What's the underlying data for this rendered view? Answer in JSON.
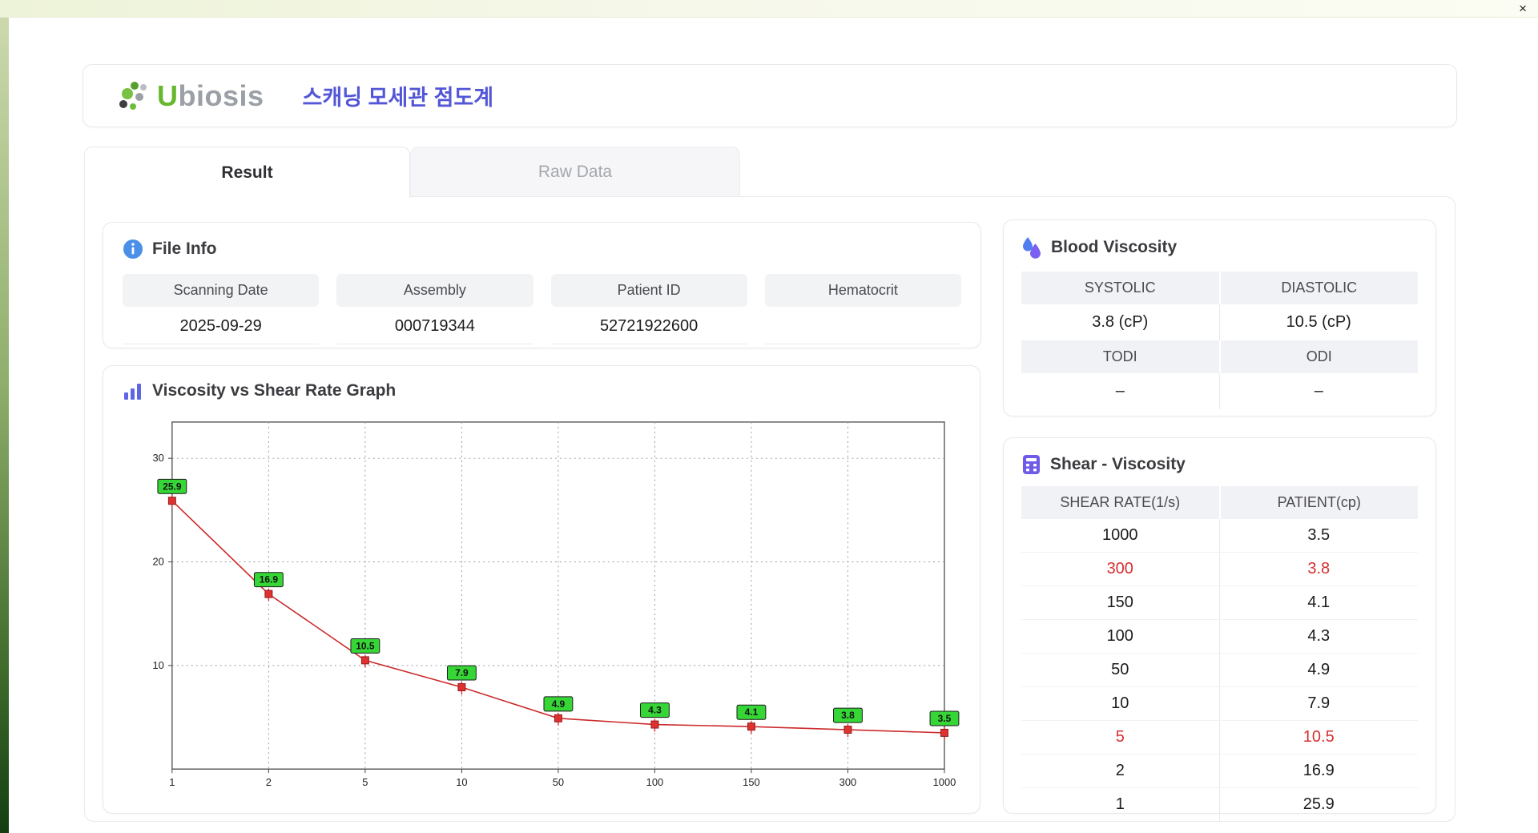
{
  "window": {
    "close_label": "×"
  },
  "header": {
    "logo_u": "U",
    "logo_rest": "biosis",
    "title": "스캐닝 모세관 점도계"
  },
  "tabs": [
    {
      "label": "Result",
      "active": true
    },
    {
      "label": "Raw Data",
      "active": false
    }
  ],
  "file_info": {
    "title": "File Info",
    "fields": [
      {
        "label": "Scanning Date",
        "value": "2025-09-29"
      },
      {
        "label": "Assembly",
        "value": "000719344"
      },
      {
        "label": "Patient ID",
        "value": "52721922600"
      },
      {
        "label": "Hematocrit",
        "value": ""
      }
    ]
  },
  "blood_viscosity": {
    "title": "Blood Viscosity",
    "cells": [
      {
        "label": "SYSTOLIC",
        "value": "3.8 (cP)"
      },
      {
        "label": "DIASTOLIC",
        "value": "10.5 (cP)"
      },
      {
        "label": "TODI",
        "value": "–"
      },
      {
        "label": "ODI",
        "value": "–"
      }
    ]
  },
  "graph": {
    "title": "Viscosity vs Shear Rate Graph"
  },
  "chart_data": {
    "type": "line",
    "title": "Viscosity vs Shear Rate Graph",
    "x": [
      1,
      2,
      5,
      10,
      50,
      100,
      150,
      300,
      1000
    ],
    "x_labels": [
      "1",
      "2",
      "5",
      "10",
      "50",
      "100",
      "150",
      "300",
      "1000"
    ],
    "values": [
      25.9,
      16.9,
      10.5,
      7.9,
      4.9,
      4.3,
      4.1,
      3.8,
      3.5
    ],
    "xlabel": "",
    "ylabel": "",
    "x_scale": "categorical-log-ticks",
    "ylim": [
      0,
      33.5
    ],
    "yticks": [
      10,
      20,
      30
    ],
    "grid": true,
    "legend": "none",
    "line_color": "#cc2a2a",
    "marker_color": "#e03131",
    "marker_edge": "#8f1d1d",
    "label_bg": "#35d635",
    "label_border": "#1a1a1a"
  },
  "shear_table": {
    "title": "Shear - Viscosity",
    "columns": [
      "SHEAR RATE(1/s)",
      "PATIENT(cp)"
    ],
    "rows": [
      {
        "rate": "1000",
        "patient": "3.5",
        "highlight": false
      },
      {
        "rate": "300",
        "patient": "3.8",
        "highlight": true
      },
      {
        "rate": "150",
        "patient": "4.1",
        "highlight": false
      },
      {
        "rate": "100",
        "patient": "4.3",
        "highlight": false
      },
      {
        "rate": "50",
        "patient": "4.9",
        "highlight": false
      },
      {
        "rate": "10",
        "patient": "7.9",
        "highlight": false
      },
      {
        "rate": "5",
        "patient": "10.5",
        "highlight": true
      },
      {
        "rate": "2",
        "patient": "16.9",
        "highlight": false
      },
      {
        "rate": "1",
        "patient": "25.9",
        "highlight": false
      }
    ]
  },
  "icons": {
    "file_info": "info-icon",
    "blood_viscosity": "droplets-icon",
    "graph": "bar-chart-icon",
    "shear_table": "calculator-icon",
    "logo": "ubiosis-dots-logo",
    "close": "close-icon"
  },
  "colors": {
    "accent_purple": "#5356d6",
    "logo_green": "#67b82f",
    "highlight_red": "#d63031",
    "label_green": "#35d635",
    "header_gray": "#f1f2f5"
  }
}
